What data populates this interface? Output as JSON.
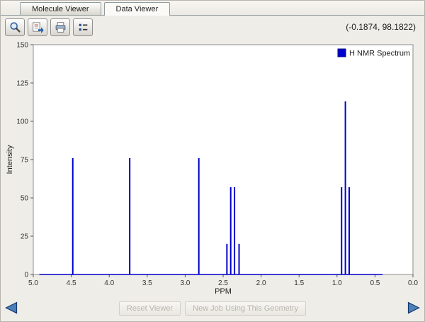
{
  "window": {
    "title": "Data Viewer"
  },
  "tabs": [
    {
      "label": "Molecule Viewer",
      "active": false
    },
    {
      "label": "Data Viewer",
      "active": true
    }
  ],
  "toolbar": {
    "coordinates": "(-0.1874, 98.1822)",
    "icons": [
      "zoom-icon",
      "export-image-icon",
      "print-icon",
      "legend-toggle-icon"
    ]
  },
  "footer": {
    "reset_label": "Reset Viewer",
    "new_job_label": "New Job Using This Geometry",
    "prev_arrow": "left-arrow-icon",
    "next_arrow": "right-arrow-icon"
  },
  "colors": {
    "spectrum": "#0000cc",
    "plot_border": "#8c8c8c",
    "background": "#efede8"
  },
  "chart_data": {
    "type": "line",
    "subtype": "stick-spectrum",
    "title": "",
    "xlabel": "PPM",
    "ylabel": "Intensity",
    "xlim": [
      5.0,
      0.0
    ],
    "ylim": [
      0,
      150
    ],
    "x_ticks": [
      5.0,
      4.5,
      4.0,
      3.5,
      3.0,
      2.5,
      2.0,
      1.5,
      1.0,
      0.5,
      0.0
    ],
    "y_ticks": [
      0,
      25,
      50,
      75,
      100,
      125,
      150
    ],
    "grid": false,
    "legend_position": "top-right",
    "baseline": {
      "from": 4.92,
      "to": 0.4,
      "intensity": 0
    },
    "series": [
      {
        "name": "H NMR Spectrum",
        "color": "#0000cc",
        "peaks": [
          {
            "ppm": 4.48,
            "intensity": 76
          },
          {
            "ppm": 3.73,
            "intensity": 76
          },
          {
            "ppm": 2.82,
            "intensity": 76
          },
          {
            "ppm": 2.45,
            "intensity": 20
          },
          {
            "ppm": 2.4,
            "intensity": 57
          },
          {
            "ppm": 2.35,
            "intensity": 57
          },
          {
            "ppm": 2.29,
            "intensity": 20
          },
          {
            "ppm": 0.94,
            "intensity": 57
          },
          {
            "ppm": 0.89,
            "intensity": 113
          },
          {
            "ppm": 0.84,
            "intensity": 57
          }
        ]
      }
    ]
  }
}
